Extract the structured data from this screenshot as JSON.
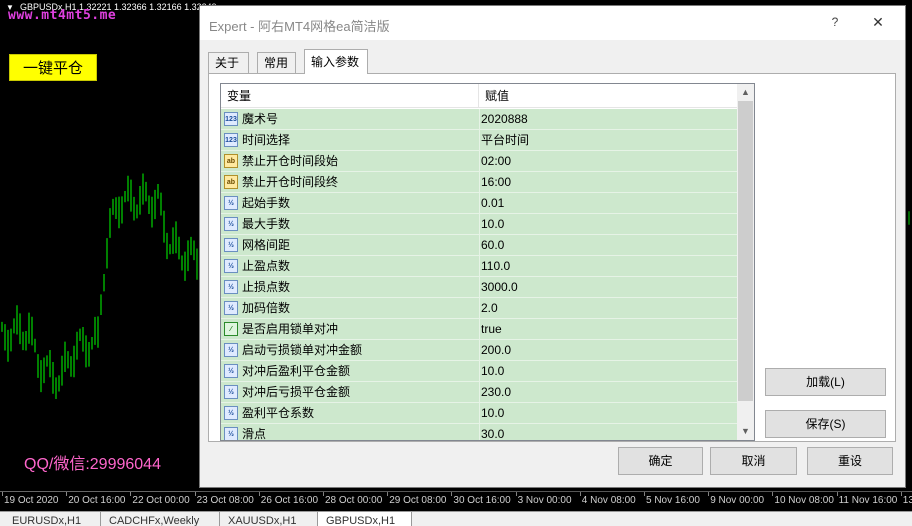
{
  "chart": {
    "title": "GBPUSDx,H1  1.32221 1.32366 1.32166 1.32249",
    "watermark": "www.mt4mt5.me",
    "close_all_button": "一键平仓",
    "contact": "QQ/微信:29996044",
    "candle_color": "#00ff00",
    "time_labels": [
      "19 Oct 2020",
      "20 Oct 16:00",
      "22 Oct 00:00",
      "23 Oct 08:00",
      "26 Oct 16:00",
      "28 Oct 00:00",
      "29 Oct 08:00",
      "30 Oct 16:00",
      "3 Nov 00:00",
      "4 Nov 08:00",
      "5 Nov 16:00",
      "9 Nov 00:00",
      "10 Nov 08:00",
      "11 Nov 16:00",
      "13"
    ],
    "tabs": [
      "EURUSDx,H1",
      "CADCHFx,Weekly",
      "XAUUSDx,H1",
      "GBPUSDx,H1"
    ],
    "active_tab": "GBPUSDx,H1"
  },
  "dialog": {
    "title": "Expert - 阿右MT4网格ea简洁版",
    "help_label": "?",
    "close_label": "✕",
    "tabs": [
      "关于",
      "常用",
      "输入参数"
    ],
    "active_tab": "输入参数",
    "grid": {
      "header_variable": "变量",
      "header_value": "赋值",
      "rows": [
        {
          "icon": "123",
          "kind": "int",
          "variable": "魔术号",
          "value": "2020888"
        },
        {
          "icon": "123",
          "kind": "int",
          "variable": "时间选择",
          "value": "平台时间"
        },
        {
          "icon": "ab",
          "kind": "string",
          "variable": "禁止开仓时间段始",
          "value": "02:00"
        },
        {
          "icon": "ab",
          "kind": "string",
          "variable": "禁止开仓时间段终",
          "value": "16:00"
        },
        {
          "icon": "½",
          "kind": "double",
          "variable": "起始手数",
          "value": "0.01"
        },
        {
          "icon": "½",
          "kind": "double",
          "variable": "最大手数",
          "value": "10.0"
        },
        {
          "icon": "½",
          "kind": "double",
          "variable": "网格间距",
          "value": "60.0"
        },
        {
          "icon": "½",
          "kind": "double",
          "variable": "止盈点数",
          "value": "110.0"
        },
        {
          "icon": "½",
          "kind": "double",
          "variable": "止损点数",
          "value": "3000.0"
        },
        {
          "icon": "½",
          "kind": "double",
          "variable": "加码倍数",
          "value": "2.0"
        },
        {
          "icon": "⁄",
          "kind": "bool",
          "variable": "是否启用锁单对冲",
          "value": "true"
        },
        {
          "icon": "½",
          "kind": "double",
          "variable": "启动亏损锁单对冲金额",
          "value": "200.0"
        },
        {
          "icon": "½",
          "kind": "double",
          "variable": "对冲后盈利平仓金额",
          "value": "10.0"
        },
        {
          "icon": "½",
          "kind": "double",
          "variable": "对冲后亏损平仓金额",
          "value": "230.0"
        },
        {
          "icon": "½",
          "kind": "double",
          "variable": "盈利平仓系数",
          "value": "10.0"
        },
        {
          "icon": "½",
          "kind": "double",
          "variable": "滑点",
          "value": "30.0"
        }
      ]
    },
    "buttons": {
      "load": "加载(L)",
      "save": "保存(S)",
      "ok": "确定",
      "cancel": "取消",
      "reset": "重设"
    }
  }
}
